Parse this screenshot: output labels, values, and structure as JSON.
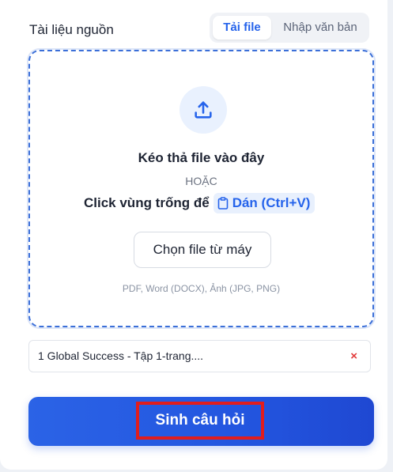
{
  "source": {
    "title": "Tài liệu nguồn",
    "tabs": [
      {
        "label": "Tải file",
        "active": true
      },
      {
        "label": "Nhập văn bản",
        "active": false
      }
    ]
  },
  "dropzone": {
    "upload_icon": "upload-icon",
    "title": "Kéo thả file vào đây",
    "or_text": "HOẶC",
    "click_text": "Click vùng trống để",
    "paste_icon": "clipboard-icon",
    "paste_label": "Dán (Ctrl+V)",
    "choose_button": "Chọn file từ máy",
    "formats": "PDF, Word (DOCX), Ảnh (JPG, PNG)"
  },
  "file": {
    "name": "1 Global Success - Tập 1-trang....",
    "remove_label": "×"
  },
  "generate": {
    "label": "Sinh câu hỏi"
  },
  "colors": {
    "accent": "#2563eb",
    "button_bg": "#2356e0",
    "highlight": "#e11d1d",
    "remove": "#e23b3b"
  }
}
